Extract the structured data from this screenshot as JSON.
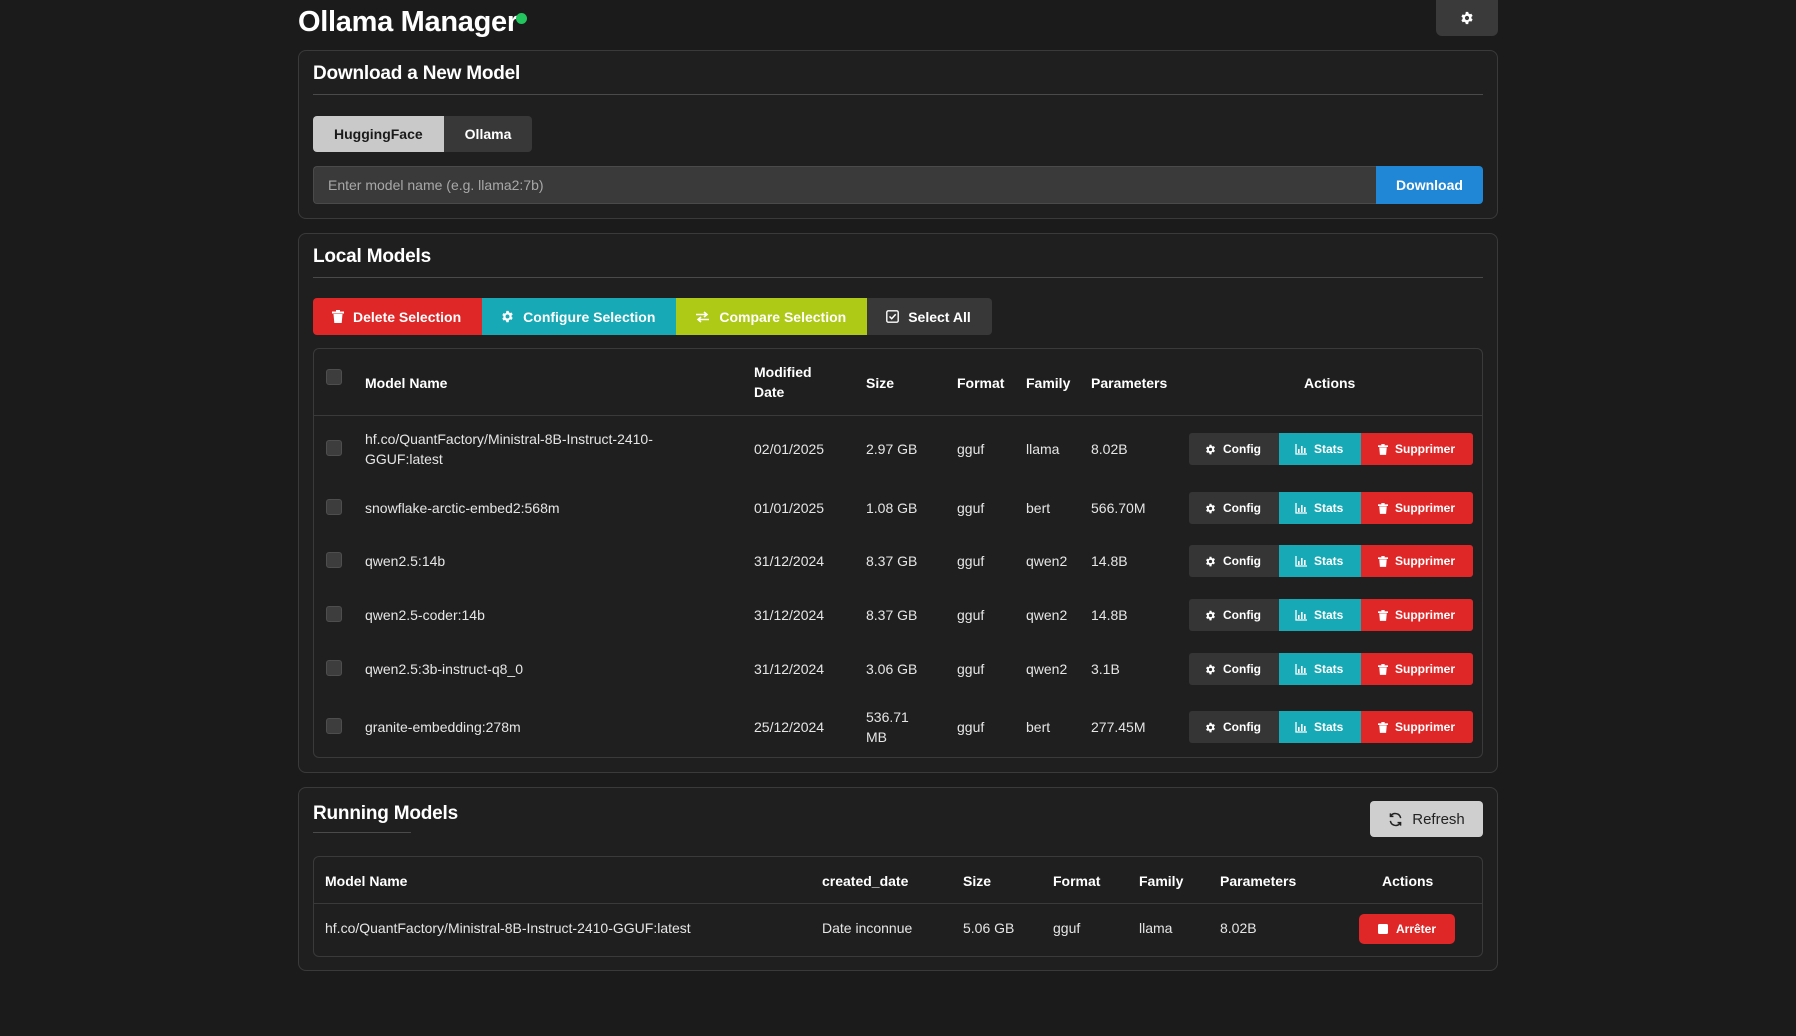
{
  "app": {
    "title": "Ollama Manager",
    "status_color": "#22c55e",
    "settings_icon": "gear-icon"
  },
  "download": {
    "title": "Download a New Model",
    "tabs": [
      {
        "label": "HuggingFace",
        "active": true
      },
      {
        "label": "Ollama",
        "active": false
      }
    ],
    "input_placeholder": "Enter model name (e.g. llama2:7b)",
    "input_value": "",
    "button_label": "Download"
  },
  "local": {
    "title": "Local Models",
    "bulk_actions": {
      "delete": "Delete Selection",
      "configure": "Configure Selection",
      "compare": "Compare Selection",
      "select_all": "Select All"
    },
    "columns": {
      "name": "Model Name",
      "modified": "Modified Date",
      "size": "Size",
      "format": "Format",
      "family": "Family",
      "parameters": "Parameters",
      "actions": "Actions"
    },
    "row_actions": {
      "config": "Config",
      "stats": "Stats",
      "delete": "Supprimer"
    },
    "rows": [
      {
        "name": "hf.co/QuantFactory/Ministral-8B-Instruct-2410-GGUF:latest",
        "modified": "02/01/2025",
        "size": "2.97 GB",
        "format": "gguf",
        "family": "llama",
        "parameters": "8.02B"
      },
      {
        "name": "snowflake-arctic-embed2:568m",
        "modified": "01/01/2025",
        "size": "1.08 GB",
        "format": "gguf",
        "family": "bert",
        "parameters": "566.70M"
      },
      {
        "name": "qwen2.5:14b",
        "modified": "31/12/2024",
        "size": "8.37 GB",
        "format": "gguf",
        "family": "qwen2",
        "parameters": "14.8B"
      },
      {
        "name": "qwen2.5-coder:14b",
        "modified": "31/12/2024",
        "size": "8.37 GB",
        "format": "gguf",
        "family": "qwen2",
        "parameters": "14.8B"
      },
      {
        "name": "qwen2.5:3b-instruct-q8_0",
        "modified": "31/12/2024",
        "size": "3.06 GB",
        "format": "gguf",
        "family": "qwen2",
        "parameters": "3.1B"
      },
      {
        "name": "granite-embedding:278m",
        "modified": "25/12/2024",
        "size": "536.71 MB",
        "format": "gguf",
        "family": "bert",
        "parameters": "277.45M"
      }
    ]
  },
  "running": {
    "title": "Running Models",
    "refresh_label": "Refresh",
    "columns": {
      "name": "Model Name",
      "created": "created_date",
      "size": "Size",
      "format": "Format",
      "family": "Family",
      "parameters": "Parameters",
      "actions": "Actions"
    },
    "stop_label": "Arrêter",
    "rows": [
      {
        "name": "hf.co/QuantFactory/Ministral-8B-Instruct-2410-GGUF:latest",
        "created": "Date inconnue",
        "size": "5.06 GB",
        "format": "gguf",
        "family": "llama",
        "parameters": "8.02B"
      }
    ]
  },
  "colors": {
    "danger": "#df2727",
    "info": "#17a9b5",
    "lime": "#aec916",
    "primary": "#1f87d6"
  }
}
